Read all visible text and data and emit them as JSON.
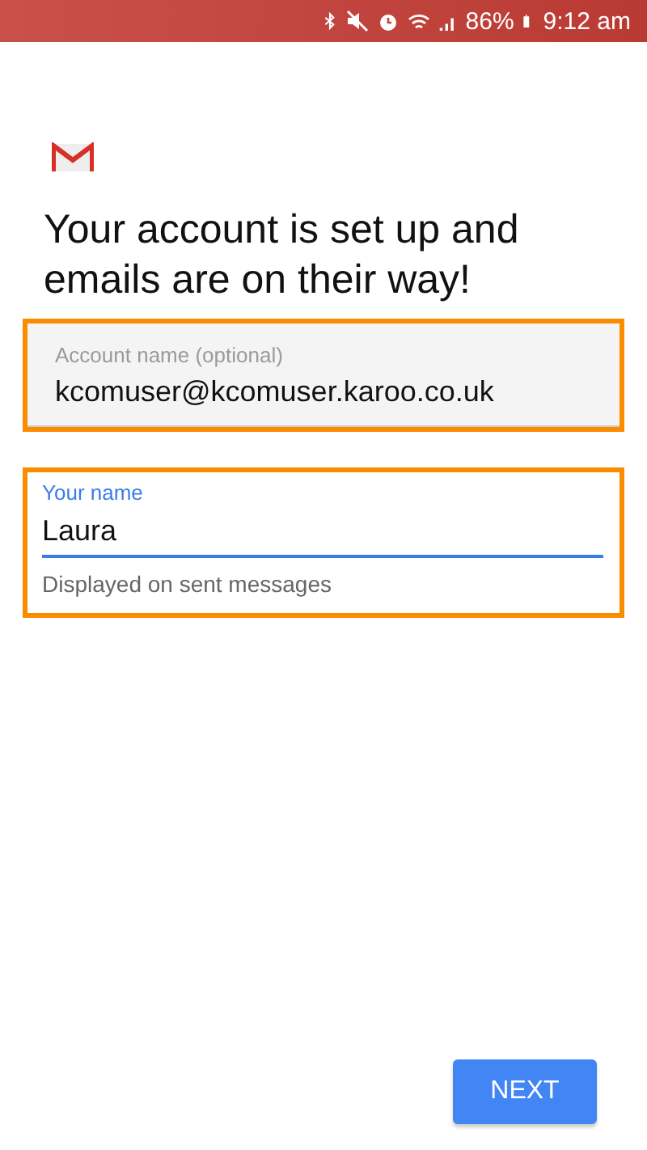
{
  "status_bar": {
    "battery_text": "86%",
    "time": "9:12 am"
  },
  "heading": "Your account is set up and emails are on their way!",
  "fields": [
    {
      "kind": "filled",
      "label": "Account name (optional)",
      "value": "kcomuser@kcomuser.karoo.co.uk",
      "focused": false
    },
    {
      "kind": "underlined",
      "label": "Your name",
      "value": "Laura",
      "helper": "Displayed on sent messages",
      "focused": true
    }
  ],
  "next_button": "NEXT"
}
